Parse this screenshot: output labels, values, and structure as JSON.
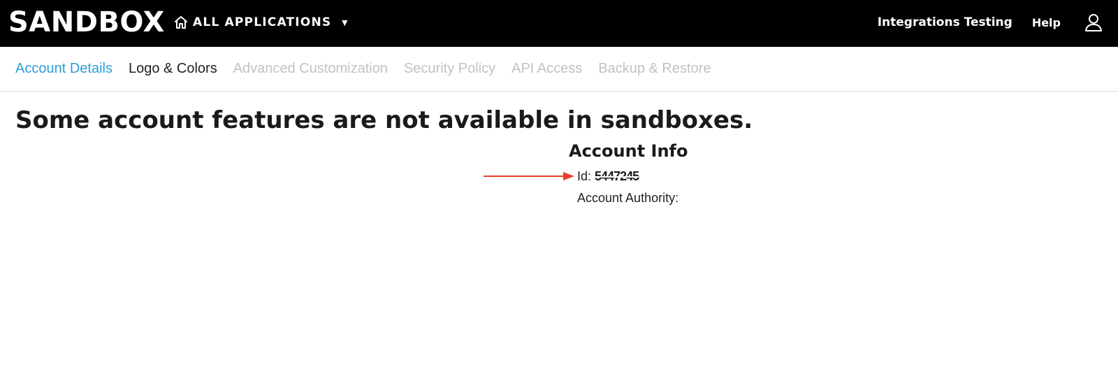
{
  "header": {
    "brand": "SANDBOX",
    "app_switcher_label": "ALL APPLICATIONS",
    "app_switcher_caret": "▼",
    "org_name": "Integrations Testing",
    "help_label": "Help"
  },
  "tabs": [
    {
      "label": "Account Details",
      "state": "active"
    },
    {
      "label": "Logo & Colors",
      "state": "normal"
    },
    {
      "label": "Advanced Customization",
      "state": "disabled"
    },
    {
      "label": "Security Policy",
      "state": "disabled"
    },
    {
      "label": "API Access",
      "state": "disabled"
    },
    {
      "label": "Backup & Restore",
      "state": "disabled"
    }
  ],
  "main": {
    "notice": "Some account features are not available in sandboxes.",
    "account_info": {
      "title": "Account Info",
      "id_label": "Id:",
      "id_value": "5447245",
      "authority_label": "Account Authority:",
      "authority_value": ""
    }
  },
  "annotation": {
    "arrow_color": "#e8402a"
  },
  "colors": {
    "topbar_bg": "#000000",
    "active_tab": "#2a9fd6",
    "disabled_tab": "#c2c2c2"
  }
}
